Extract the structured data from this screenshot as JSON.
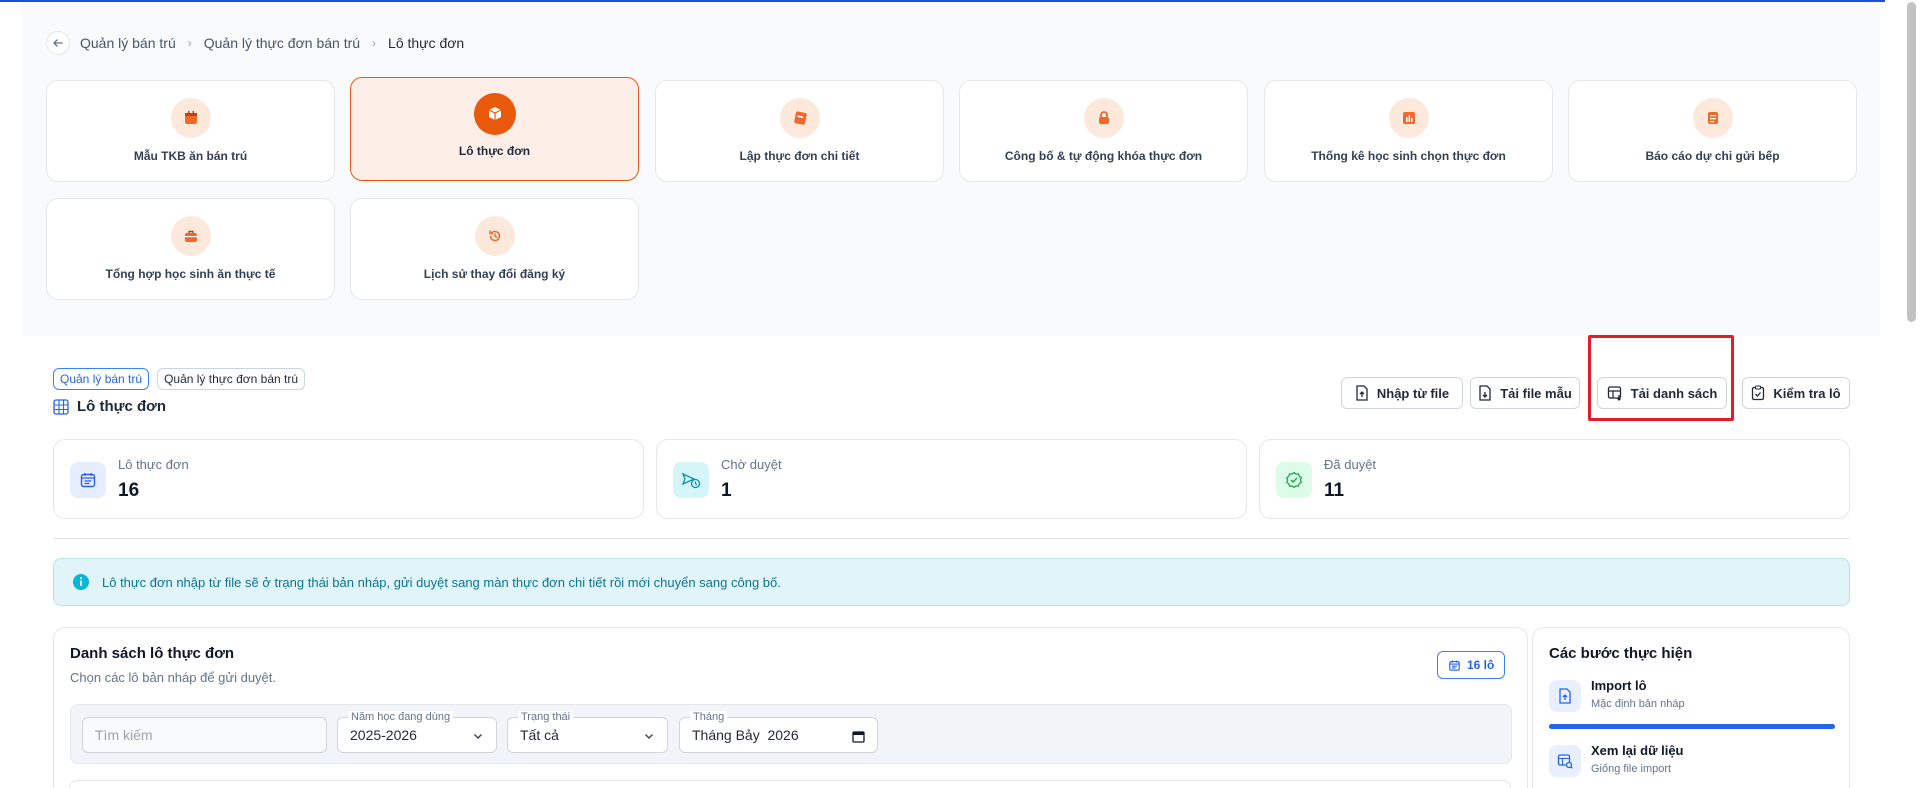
{
  "breadcrumb": {
    "items": [
      "Quản lý bán trú",
      "Quản lý thực đơn bán trú",
      "Lô thực đơn"
    ]
  },
  "module_cards": [
    {
      "label": "Mẫu TKB ăn bán trú",
      "icon": "calendar-icon",
      "active": false
    },
    {
      "label": "Lô thực đơn",
      "icon": "box-icon",
      "active": true
    },
    {
      "label": "Lập thực đơn chi tiết",
      "icon": "menu-book-icon",
      "active": false
    },
    {
      "label": "Công bố & tự động khóa thực đơn",
      "icon": "lock-icon",
      "active": false
    },
    {
      "label": "Thống kê học sinh chọn thực đơn",
      "icon": "bar-chart-icon",
      "active": false
    },
    {
      "label": "Báo cáo dự chi gửi bếp",
      "icon": "report-icon",
      "active": false
    },
    {
      "label": "Tổng hợp học sinh ăn thực tế",
      "icon": "briefcase-icon",
      "active": false
    },
    {
      "label": "Lịch sử thay đổi đăng ký",
      "icon": "history-icon",
      "active": false
    }
  ],
  "tags": [
    "Quản lý bán trú",
    "Quản lý thực đơn bán trú"
  ],
  "page_title": "Lô thực đơn",
  "actions": {
    "import": "Nhập từ file",
    "download_template": "Tải file mẫu",
    "download_list": "Tải danh sách",
    "check": "Kiểm tra lô"
  },
  "stats": [
    {
      "label": "Lô thực đơn",
      "value": "16",
      "icon": "calendar-list-icon",
      "color": "#2563eb"
    },
    {
      "label": "Chờ duyệt",
      "value": "1",
      "icon": "pending-send-icon",
      "color": "#0891b2"
    },
    {
      "label": "Đã duyệt",
      "value": "11",
      "icon": "approved-badge-icon",
      "color": "#16a34a"
    }
  ],
  "alert": {
    "text": "Lô thực đơn nhập từ file sẽ ở trạng thái bản nháp, gửi duyệt sang màn thực đơn chi tiết rồi mới chuyển sang công bố."
  },
  "list_panel": {
    "title": "Danh sách lô thực đơn",
    "subtitle": "Chọn các lô bản nháp để gửi duyệt.",
    "count_badge": "16 lô",
    "filters": {
      "search_placeholder": "Tìm kiếm",
      "year_label": "Năm học đang dùng",
      "year_value": "2025-2026",
      "status_label": "Trạng thái",
      "status_value": "Tất cả",
      "month_label": "Tháng",
      "month_value": "Tháng Bảy  2026"
    }
  },
  "steps_panel": {
    "title": "Các bước thực hiện",
    "steps": [
      {
        "title": "Import lô",
        "subtitle": "Mặc định bản nháp"
      },
      {
        "title": "Xem lại dữ liệu",
        "subtitle": "Giống file import"
      }
    ],
    "progress": 1.0
  },
  "colors": {
    "accent_orange": "#e8590c",
    "primary_blue": "#2563eb",
    "highlight_red": "#e11d2a"
  }
}
